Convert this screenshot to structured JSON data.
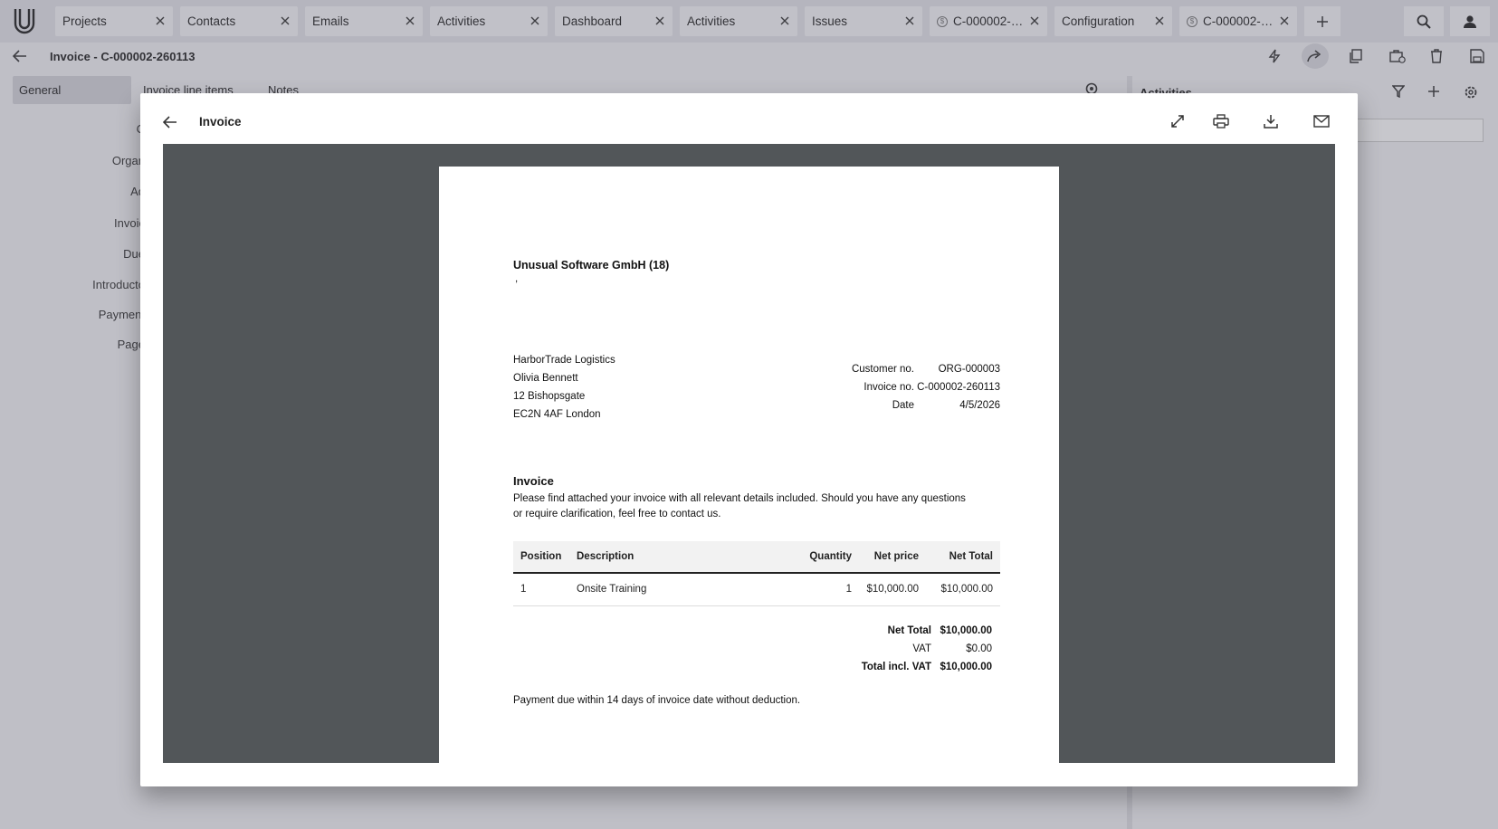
{
  "tabs": [
    {
      "label": "Projects"
    },
    {
      "label": "Contacts"
    },
    {
      "label": "Emails"
    },
    {
      "label": "Activities"
    },
    {
      "label": "Dashboard"
    },
    {
      "label": "Activities"
    },
    {
      "label": "Issues"
    },
    {
      "label": "C-000002-26..."
    },
    {
      "label": "Configuration"
    },
    {
      "label": "C-000002-26..."
    }
  ],
  "header": {
    "title": "Invoice - C-000002-260113"
  },
  "left_tabs": [
    "General",
    "Invoice line items",
    "Notes"
  ],
  "form_labels": [
    "C",
    "Organ",
    "Ad",
    "Invoic",
    "Due",
    "Introducto",
    "Payment",
    "Page"
  ],
  "right_panel": {
    "title": "Activities"
  },
  "dialog": {
    "title": "Invoice"
  },
  "invoice": {
    "company": "Unusual Software GmbH (18)",
    "company_sub": ",",
    "recipient": [
      "HarborTrade Logistics",
      "Olivia Bennett",
      "12 Bishopsgate",
      "EC2N 4AF London"
    ],
    "meta": [
      {
        "label": "Customer no.",
        "value": "ORG-000003"
      },
      {
        "label": "Invoice no.",
        "value": "C-000002-260113"
      },
      {
        "label": "Date",
        "value": "4/5/2026"
      }
    ],
    "heading": "Invoice",
    "intro": "Please find attached your invoice with all relevant details included. Should you have any questions or require clarification, feel free to contact us.",
    "columns": [
      "Position",
      "Description",
      "Quantity",
      "Net price",
      "Net Total"
    ],
    "lines": [
      {
        "position": "1",
        "description": "Onsite Training",
        "quantity": "1",
        "net_price": "$10,000.00",
        "net_total": "$10,000.00"
      }
    ],
    "totals": [
      {
        "label": "Net Total",
        "value": "$10,000.00",
        "bold": true
      },
      {
        "label": "VAT",
        "value": "$0.00",
        "bold": false
      },
      {
        "label": "Total incl. VAT",
        "value": "$10,000.00",
        "bold": true
      }
    ],
    "footer": "Payment due within 14 days of invoice date without deduction."
  },
  "colors": {
    "viewer_bg": "#525659",
    "tabbar_bg": "#e5e5ea",
    "selected_tab": "#d6d6dc"
  }
}
